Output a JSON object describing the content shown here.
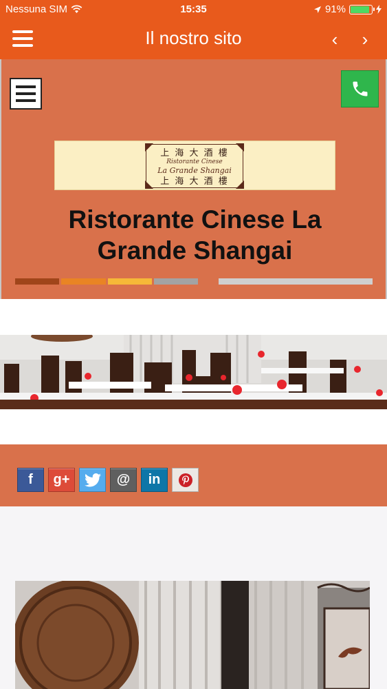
{
  "status_bar": {
    "carrier": "Nessuna SIM",
    "time": "15:35",
    "battery_percent": "91%",
    "battery_level": 0.91
  },
  "nav": {
    "title": "Il nostro sito",
    "back_glyph": "‹",
    "forward_glyph": "›",
    "icons": [
      "hamburger-menu-icon",
      "chevron-left-icon",
      "chevron-right-icon"
    ]
  },
  "site": {
    "title": "Ristorante Cinese La Grande Shangai",
    "logo": {
      "chars_top": "上 海 大 酒 樓",
      "subtitle": "Ristorante Cinese",
      "name": "La Grande Shangai",
      "chars_bottom": "上 海 大 酒 樓"
    },
    "stripe_colors": [
      "#a0451a",
      "#e98424",
      "#f6b838",
      "#a3a3a3",
      "#cfcfcf"
    ]
  },
  "social": [
    {
      "name": "facebook",
      "label": "f",
      "color": "#3b5998"
    },
    {
      "name": "google-plus",
      "label": "g+",
      "color": "#dd4b39"
    },
    {
      "name": "twitter",
      "label": "t",
      "color": "#55acee"
    },
    {
      "name": "email",
      "label": "@",
      "color": "#5f5f5f"
    },
    {
      "name": "linkedin",
      "label": "in",
      "color": "#0e76a8"
    },
    {
      "name": "pinterest",
      "label": "p",
      "color": "#ece8e4"
    }
  ],
  "colors": {
    "app_bar": "#e85a1c",
    "section_bg": "#d9714b",
    "call_button": "#2fb64c"
  }
}
